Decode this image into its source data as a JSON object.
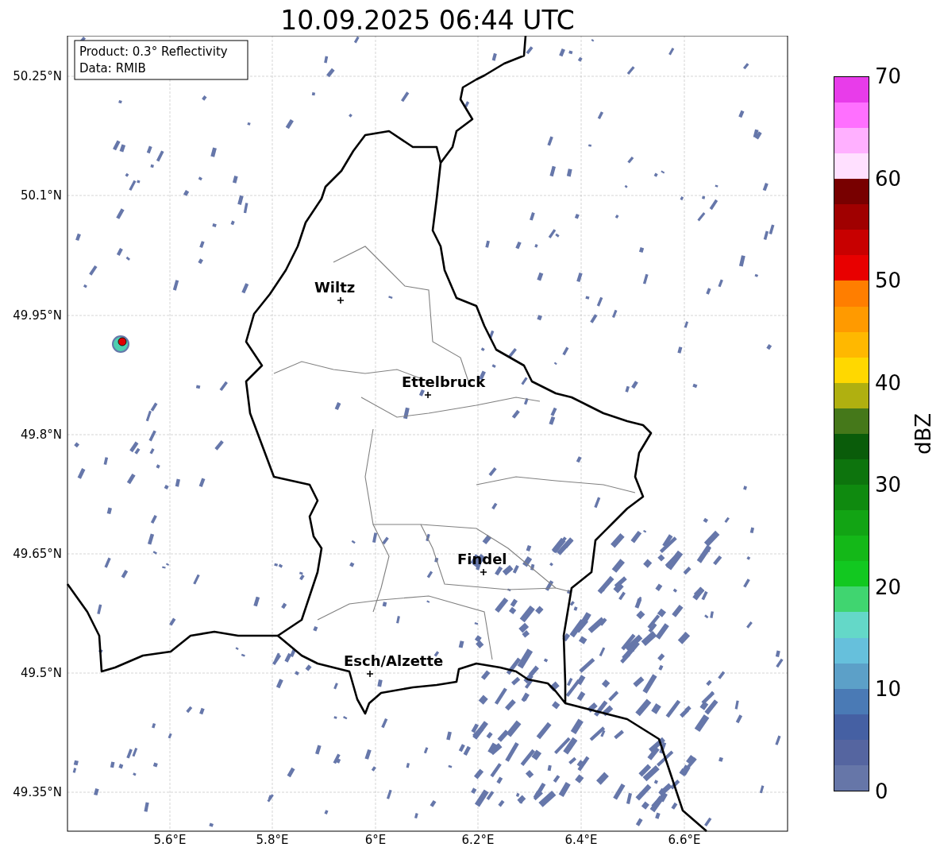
{
  "title": "10.09.2025 06:44 UTC",
  "info_box": [
    "Product: 0.3° Reflectivity",
    "Data: RMIB"
  ],
  "map": {
    "lat_ticks": [
      "50.25°N",
      "50.1°N",
      "49.95°N",
      "49.8°N",
      "49.65°N",
      "49.5°N",
      "49.35°N"
    ],
    "lon_ticks": [
      "5.6°E",
      "5.8°E",
      "6°E",
      "6.2°E",
      "6.4°E",
      "6.6°E"
    ],
    "cities": [
      {
        "name": "Wiltz"
      },
      {
        "name": "Ettelbruck"
      },
      {
        "name": "Findel"
      },
      {
        "name": "Esch/Alzette"
      }
    ]
  },
  "colorbar": {
    "label": "dBZ",
    "ticks": [
      "70",
      "60",
      "50",
      "40",
      "30",
      "20",
      "10",
      "0"
    ],
    "bins": [
      {
        "color": "#6676a8"
      },
      {
        "color": "#5565a0"
      },
      {
        "color": "#4560a3"
      },
      {
        "color": "#4a7ab5"
      },
      {
        "color": "#5ca0c8"
      },
      {
        "color": "#66c0dc"
      },
      {
        "color": "#64d8c8"
      },
      {
        "color": "#40d570"
      },
      {
        "color": "#12c820"
      },
      {
        "color": "#14b818"
      },
      {
        "color": "#12a414"
      },
      {
        "color": "#0f8a0f"
      },
      {
        "color": "#0d740d"
      },
      {
        "color": "#0a5c0a"
      },
      {
        "color": "#45781a"
      },
      {
        "color": "#b0b010"
      },
      {
        "color": "#ffd800"
      },
      {
        "color": "#ffb800"
      },
      {
        "color": "#ff9a00"
      },
      {
        "color": "#ff7e00"
      },
      {
        "color": "#e80000"
      },
      {
        "color": "#c80000"
      },
      {
        "color": "#a00000"
      },
      {
        "color": "#780000"
      },
      {
        "color": "#ffe0ff"
      },
      {
        "color": "#ffb0ff"
      },
      {
        "color": "#ff70ff"
      },
      {
        "color": "#e83cea"
      }
    ]
  }
}
